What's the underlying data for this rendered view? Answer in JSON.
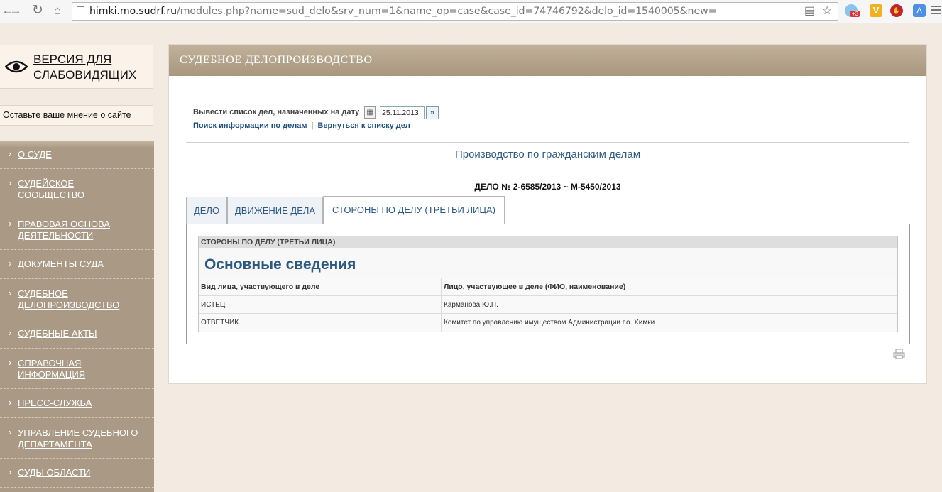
{
  "browser": {
    "url_host": "himki.mo.sudrf.ru",
    "url_rest": "/modules.php?name=sud_delo&srv_num=1&name_op=case&case_id=74746792&delo_id=1540005&new=",
    "ext_badge": "+3"
  },
  "sidebar": {
    "vision_label_1": "Версия для",
    "vision_label_2": "слабовидящих",
    "opinion_link": "Оставьте ваше мнение о сайте",
    "menu": [
      {
        "arrow": "›",
        "line1": "О суде",
        "line2": ""
      },
      {
        "arrow": "›",
        "line1": "Судейское",
        "line2": "сообщество"
      },
      {
        "arrow": "›",
        "line1": "Правовая основа",
        "line2": "деятельности"
      },
      {
        "arrow": "›",
        "line1": "Документы суда",
        "line2": ""
      },
      {
        "arrow": "›",
        "line1": "Судебное",
        "line2": "делопроизводство"
      },
      {
        "arrow": "›",
        "line1": "Судебные акты",
        "line2": ""
      },
      {
        "arrow": "›",
        "line1": "Справочная",
        "line2": "информация"
      },
      {
        "arrow": "›",
        "line1": "Пресс-служба",
        "line2": ""
      },
      {
        "arrow": "›",
        "line1": "Управление судебного",
        "line2": "департамента"
      },
      {
        "arrow": "›",
        "line1": "Суды области",
        "line2": ""
      }
    ]
  },
  "main": {
    "header": "Судебное делопроизводство",
    "filter_label": "Вывести список дел, назначенных на дату",
    "date_value": "25.11.2013",
    "link_search": "Поиск информации по делам",
    "link_separator": "|",
    "link_back": "Вернуться к списку дел",
    "section_title": "Производство по гражданским делам",
    "case_number": "ДЕЛО № 2-6585/2013 ~ М-5450/2013",
    "tabs": [
      {
        "label": "Дело"
      },
      {
        "label": "Движение дела"
      },
      {
        "label": "Стороны по делу (третьи лица)"
      }
    ],
    "table": {
      "caption": "Стороны по делу (третьи лица)",
      "subtitle": "Основные сведения",
      "col1": "Вид лица, участвующего в деле",
      "col2": "Лицо, участвующее в деле (ФИО, наименование)",
      "rows": [
        {
          "role": "ИСТЕЦ",
          "party": "Карманова Ю.П."
        },
        {
          "role": "ОТВЕТЧИК",
          "party": "Комитет по управлению имуществом Администрации г.о. Химки"
        }
      ]
    }
  }
}
